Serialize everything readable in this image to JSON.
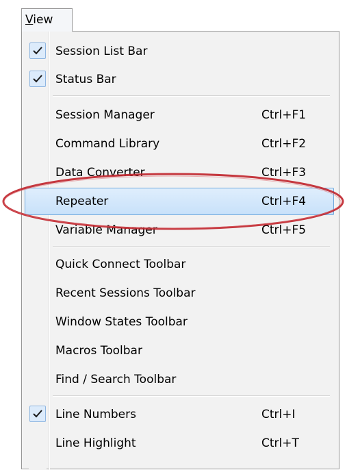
{
  "menubar": {
    "view_mnemonic": "V",
    "view_rest": "iew"
  },
  "menu": {
    "items": [
      {
        "label": "Session List Bar",
        "shortcut": "",
        "checked": true
      },
      {
        "label": "Status Bar",
        "shortcut": "",
        "checked": true
      },
      {
        "label": "Session Manager",
        "shortcut": "Ctrl+F1",
        "checked": false
      },
      {
        "label": "Command Library",
        "shortcut": "Ctrl+F2",
        "checked": false
      },
      {
        "label": "Data Converter",
        "shortcut": "Ctrl+F3",
        "checked": false
      },
      {
        "label": "Repeater",
        "shortcut": "Ctrl+F4",
        "checked": false,
        "highlighted": true
      },
      {
        "label": "Variable Manager",
        "shortcut": "Ctrl+F5",
        "checked": false
      },
      {
        "label": "Quick Connect Toolbar",
        "shortcut": "",
        "checked": false
      },
      {
        "label": "Recent Sessions Toolbar",
        "shortcut": "",
        "checked": false
      },
      {
        "label": "Window States Toolbar",
        "shortcut": "",
        "checked": false
      },
      {
        "label": "Macros Toolbar",
        "shortcut": "",
        "checked": false
      },
      {
        "label": "Find / Search Toolbar",
        "shortcut": "",
        "checked": false
      },
      {
        "label": "Line Numbers",
        "shortcut": "Ctrl+I",
        "checked": true
      },
      {
        "label": "Line Highlight",
        "shortcut": "Ctrl+T",
        "checked": false
      }
    ]
  },
  "colors": {
    "highlight_border": "#6fa8dc",
    "highlight_fill": "#c8e1fa",
    "annotation_ellipse": "#c0232b"
  },
  "annotation": {
    "shape": "ellipse",
    "target": "Repeater"
  }
}
